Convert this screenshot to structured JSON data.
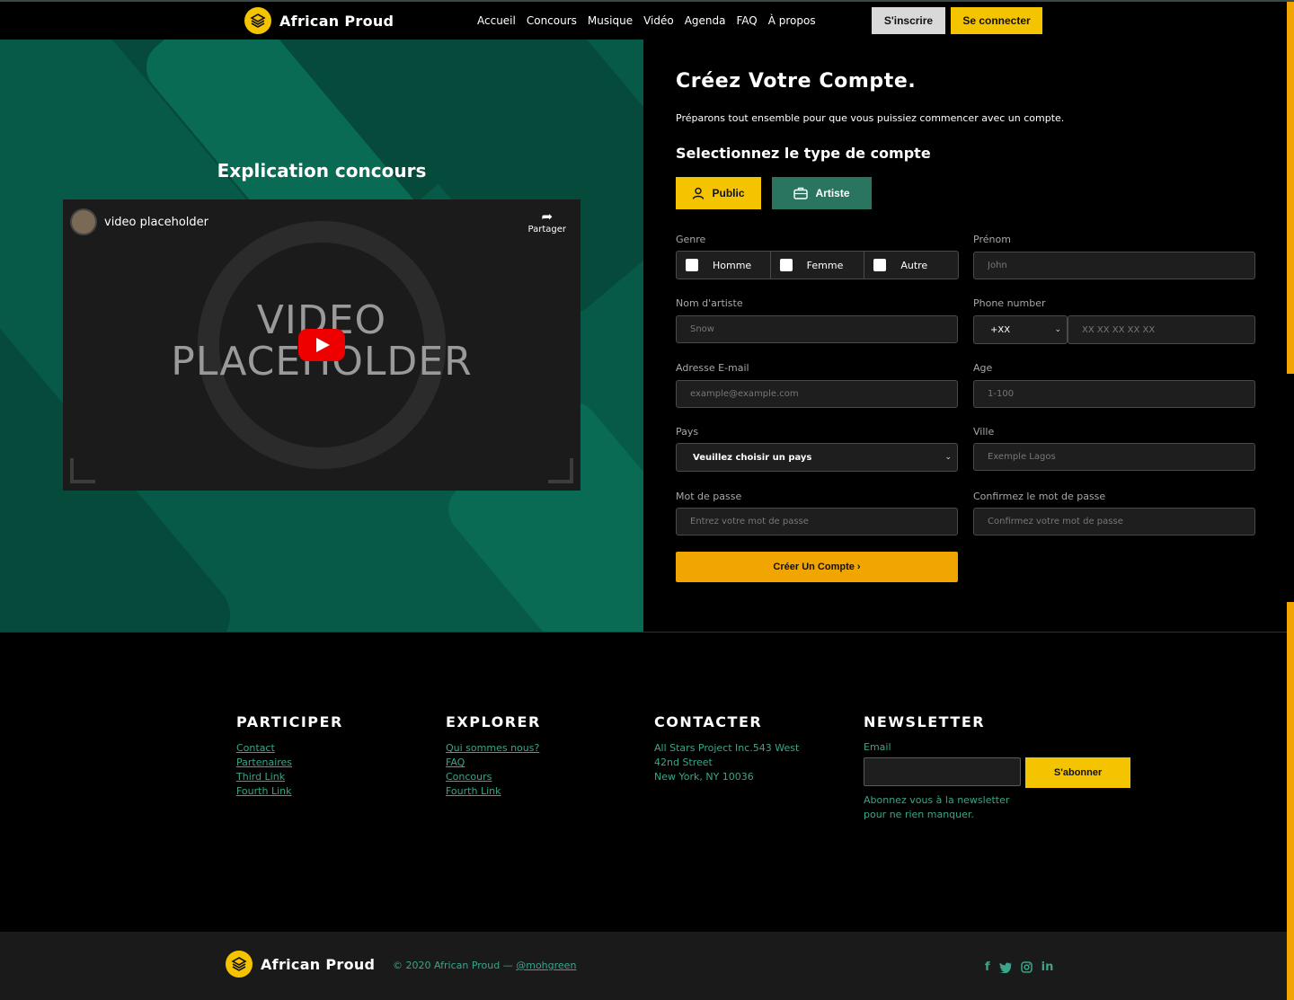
{
  "header": {
    "brand": "African Proud",
    "nav": [
      "Accueil",
      "Concours",
      "Musique",
      "Vidéo",
      "Agenda",
      "FAQ",
      "À propos"
    ],
    "signup_label": "S'inscrire",
    "login_label": "Se connecter"
  },
  "left": {
    "title": "Explication concours",
    "video": {
      "title": "video placeholder",
      "share_label": "Partager",
      "big_text_line1": "VIDEO",
      "big_text_line2": "PLACEHOLDER"
    }
  },
  "form": {
    "title": "Créez Votre Compte.",
    "subtitle": "Préparons tout ensemble pour que vous puissiez commencer avec un compte.",
    "account_type_heading": "Selectionnez le type de compte",
    "account_types": [
      "Public",
      "Artiste"
    ],
    "gender": {
      "label": "Genre",
      "options": [
        "Homme",
        "Femme",
        "Autre"
      ]
    },
    "first_name": {
      "label": "Prénom",
      "placeholder": "John"
    },
    "artist_name": {
      "label": "Nom d'artiste",
      "placeholder": "Snow"
    },
    "phone": {
      "label": "Phone number",
      "code": "+XX",
      "placeholder": "XX XX XX XX XX"
    },
    "email": {
      "label": "Adresse E-mail",
      "placeholder": "example@example.com"
    },
    "age": {
      "label": "Age",
      "placeholder": "1-100"
    },
    "country": {
      "label": "Pays",
      "selected": "Veuillez choisir un pays"
    },
    "city": {
      "label": "Ville",
      "placeholder": "Exemple Lagos"
    },
    "password": {
      "label": "Mot de passe",
      "placeholder": "Entrez votre mot de passe"
    },
    "confirm_password": {
      "label": "Confirmez le mot de passe",
      "placeholder": "Confirmez votre mot de passe"
    },
    "submit_label": "Créer Un Compte ›"
  },
  "footer": {
    "participer": {
      "heading": "PARTICIPER",
      "links": [
        "Contact",
        "Partenaires",
        "Third Link",
        "Fourth Link"
      ]
    },
    "explorer": {
      "heading": "EXPLORER",
      "links": [
        "Qui sommes nous?",
        "FAQ",
        "Concours",
        "Fourth Link"
      ]
    },
    "contacter": {
      "heading": "CONTACTER",
      "lines": [
        "All Stars Project Inc.543 West",
        "42nd Street",
        "New York, NY 10036"
      ]
    },
    "newsletter": {
      "heading": "NEWSLETTER",
      "email_label": "Email",
      "button_label": "S'abonner",
      "note": "Abonnez vous à la newsletter pour ne rien manquer."
    },
    "bottom": {
      "brand": "African Proud",
      "copyright": "© 2020 African Proud — ",
      "handle": "@mohgreen",
      "social": [
        "facebook-icon",
        "twitter-icon",
        "instagram-icon",
        "linkedin-icon"
      ]
    }
  },
  "colors": {
    "accent_yellow": "#f5c400",
    "accent_orange": "#f0a500",
    "brand_green": "#075a47",
    "artist_green": "#2a7560",
    "footer_link": "#3aa58a"
  }
}
